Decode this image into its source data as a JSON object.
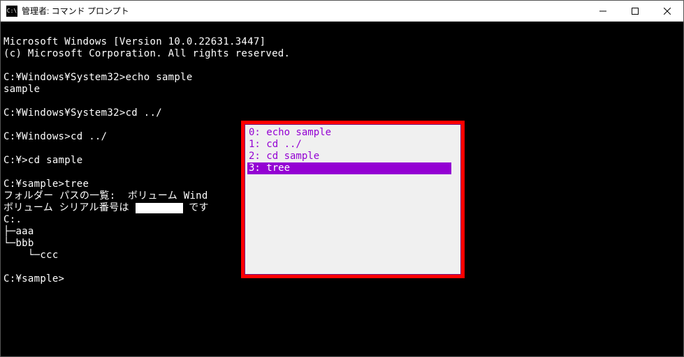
{
  "window": {
    "title": "管理者: コマンド プロンプト",
    "icon_label": "C:\\"
  },
  "controls": {
    "minimize": "minimize",
    "maximize": "maximize",
    "close": "close"
  },
  "terminal": {
    "line1": "Microsoft Windows [Version 10.0.22631.3447]",
    "line2": "(c) Microsoft Corporation. All rights reserved.",
    "line3": "",
    "line4": "C:¥Windows¥System32>echo sample",
    "line5": "sample",
    "line6": "",
    "line7": "C:¥Windows¥System32>cd ../",
    "line8": "",
    "line9": "C:¥Windows>cd ../",
    "line10": "",
    "line11": "C:¥>cd sample",
    "line12": "",
    "line13": "C:¥sample>tree",
    "line14": "フォルダー パスの一覧:  ボリューム Wind",
    "line15a": "ボリューム シリアル番号は ",
    "line15b": " です",
    "line16": "C:.",
    "line17": "├─aaa",
    "line18": "└─bbb",
    "line19": "    └─ccc",
    "line20": "",
    "line21": "C:¥sample>"
  },
  "popup": {
    "items": [
      {
        "idx": "0",
        "text": "echo sample",
        "selected": false
      },
      {
        "idx": "1",
        "text": "cd ../",
        "selected": false
      },
      {
        "idx": "2",
        "text": "cd sample",
        "selected": false
      },
      {
        "idx": "3",
        "text": "tree",
        "selected": true
      }
    ],
    "i0": "0: echo sample",
    "i1": "1: cd ../",
    "i2": "2: cd sample",
    "i3": "3: tree"
  }
}
